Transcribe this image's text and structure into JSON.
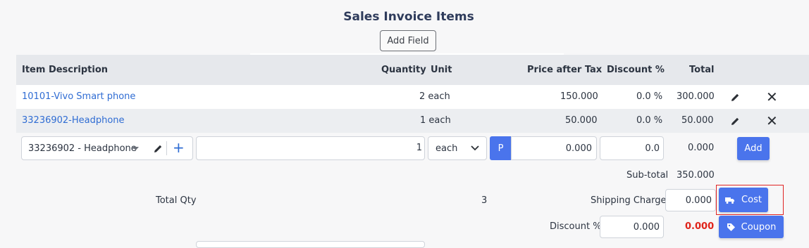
{
  "title": "Sales Invoice Items",
  "add_field_label": "Add Field",
  "columns": {
    "item_description": "Item Description",
    "quantity": "Quantity",
    "unit": "Unit",
    "price_after_tax": "Price after Tax",
    "discount": "Discount %",
    "total": "Total"
  },
  "rows": [
    {
      "description": "10101-Vivo Smart phone",
      "quantity": "2 each",
      "price": "150.000",
      "discount": "0.0 %",
      "total": "300.000"
    },
    {
      "description": "33236902-Headphone",
      "quantity": "1 each",
      "price": "50.000",
      "discount": "0.0 %",
      "total": "50.000"
    }
  ],
  "new_item": {
    "item_select": "33236902 - Headphone",
    "description": "",
    "quantity": "1",
    "unit": "each",
    "price_mode": "P",
    "price": "0.000",
    "discount": "0.0",
    "total": "0.000",
    "add_label": "Add"
  },
  "summary": {
    "subtotal_label": "Sub-total",
    "subtotal_value": "350.000",
    "total_qty_label": "Total Qty",
    "total_qty_value": "3",
    "shipping_label": "Shipping Charge",
    "shipping_value": "0.000",
    "cost_label": "Cost",
    "discount_label": "Discount %",
    "discount_value": "0.000",
    "discount_amount": "0.000",
    "coupon_label": "Coupon"
  },
  "colors": {
    "accent": "#4a74ec",
    "link": "#2f6cd3",
    "discount_amount": "#e0241b",
    "highlight": "#e02424"
  }
}
